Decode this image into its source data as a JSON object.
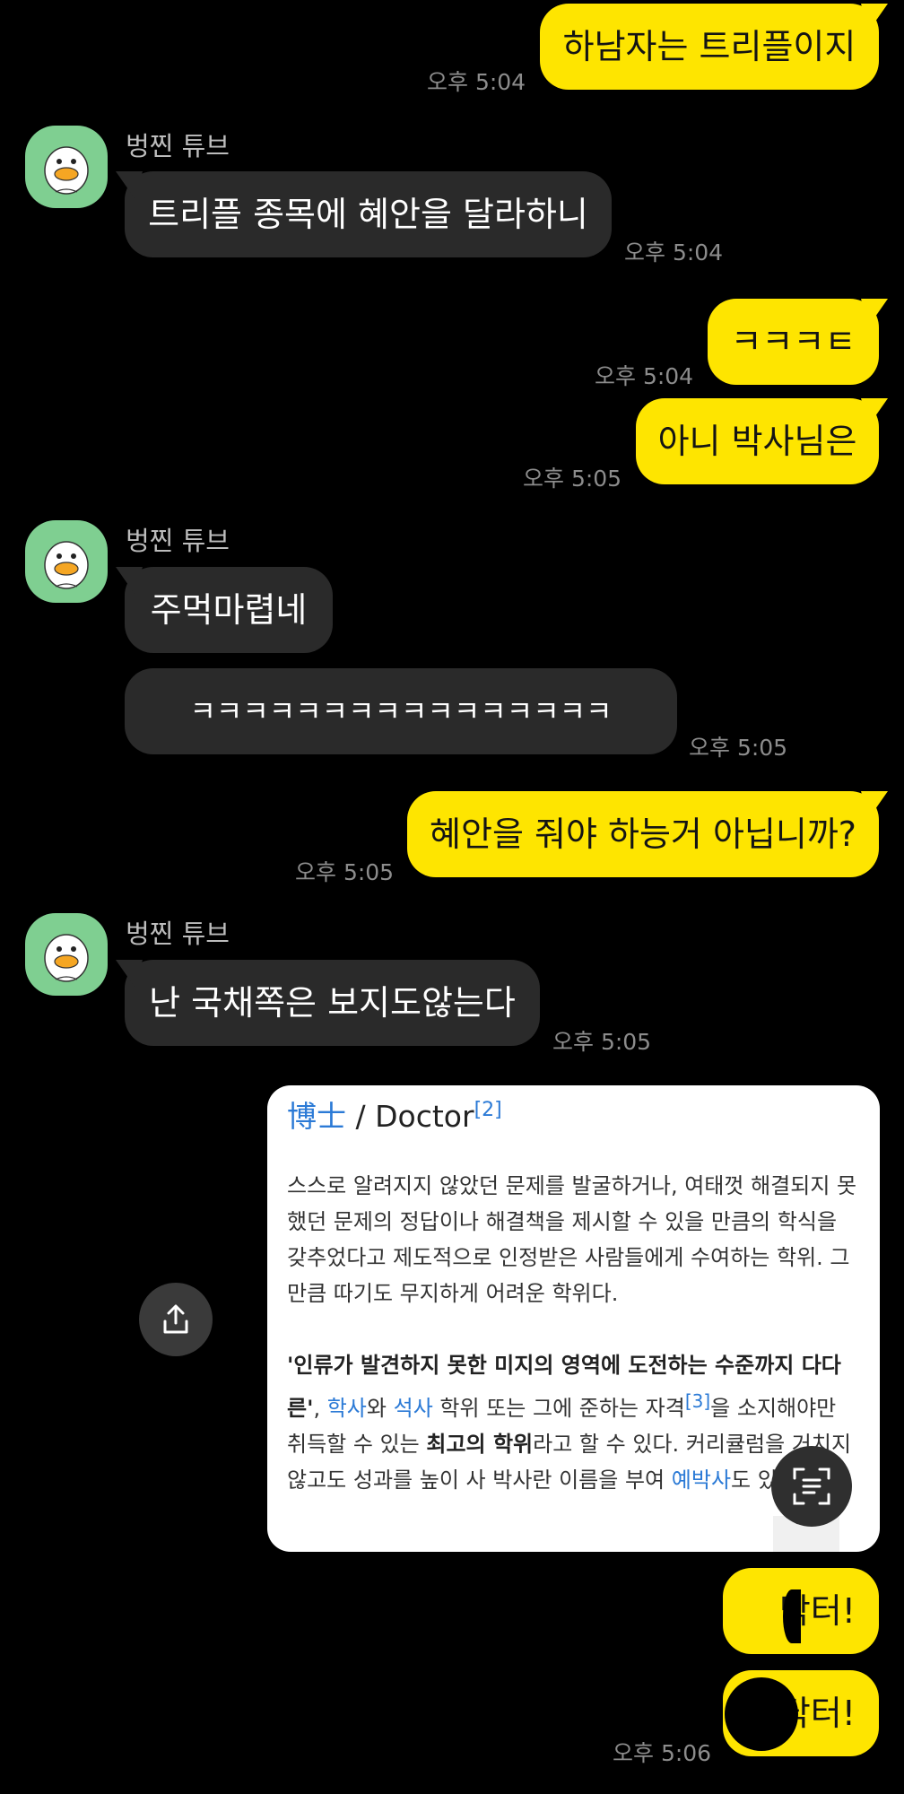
{
  "messages": {
    "m1": {
      "text": "하남자는 트리플이지",
      "time": "오후 5:04"
    },
    "m2": {
      "sender": "벙찐 튜브",
      "text": "트리플 종목에 혜안을 달라하니",
      "time": "오후 5:04"
    },
    "m3": {
      "text": "ㅋㅋㅋㅌ",
      "time": "오후 5:04"
    },
    "m4": {
      "text": "아니 박사님은",
      "time": "오후 5:05"
    },
    "m5": {
      "sender": "벙찐 튜브",
      "text": "주먹마렵네"
    },
    "m6": {
      "text": "ㅋㅋㅋㅋㅋㅋㅋㅋㅋㅋㅋㅋㅋㅋㅋㅋ",
      "time": "오후 5:05"
    },
    "m7": {
      "text": "혜안을 줘야 하능거 아닙니까?",
      "time": "오후 5:05"
    },
    "m8": {
      "sender": "벙찐 튜브",
      "text": "난 국채쪽은 보지도않는다",
      "time": "오후 5:05"
    },
    "m9": {
      "text": "닥터!"
    },
    "m10": {
      "text": "닥터!",
      "time": "오후 5:06"
    }
  },
  "doc": {
    "title_hanja": "博士",
    "title_sep": " / ",
    "title_en": "Doctor",
    "title_ref": "[2]",
    "para1": "스스로 알려지지 않았던 문제를 발굴하거나, 여태껏 해결되지 못했던 문제의 정답이나 해결책을 제시할 수 있을 만큼의 학식을 갖추었다고 제도적으로 인정받은 사람들에게 수여하는 학위. 그만큼 따기도 무지하게 어려운 학위다.",
    "p2_q1": "'",
    "p2_w1": "인류",
    "p2_t1": "가 발견하지 못한 ",
    "p2_w2": "미지",
    "p2_t2": "의 영역에 도전하는 수준까지 다다른",
    "p2_q2": "'",
    "p2_t3": ", ",
    "p2_w3": "학사",
    "p2_t4": "와 ",
    "p2_w4": "석사",
    "p2_t5": " 학위 또는 그에 준하는 자격",
    "p2_ref": "[3]",
    "p2_t6": "을 소지해야만 취득할 수 있는 ",
    "p2_b1": "최고의 학위",
    "p2_t7": "라고 할 수 있다. 커리큘럼을 거치지 않고도 성과를 높이 사 박사란 이름을 부여",
    "p2_w5": "예박사",
    "p2_t8": "도 있다."
  },
  "colors": {
    "my_bubble": "#FEE500",
    "their_bubble": "#2a2a2a",
    "background": "#000000",
    "link": "#2b7ad6"
  },
  "icons": {
    "share": "share-icon",
    "scan": "text-scan-icon",
    "avatar": "duck-avatar-icon"
  }
}
